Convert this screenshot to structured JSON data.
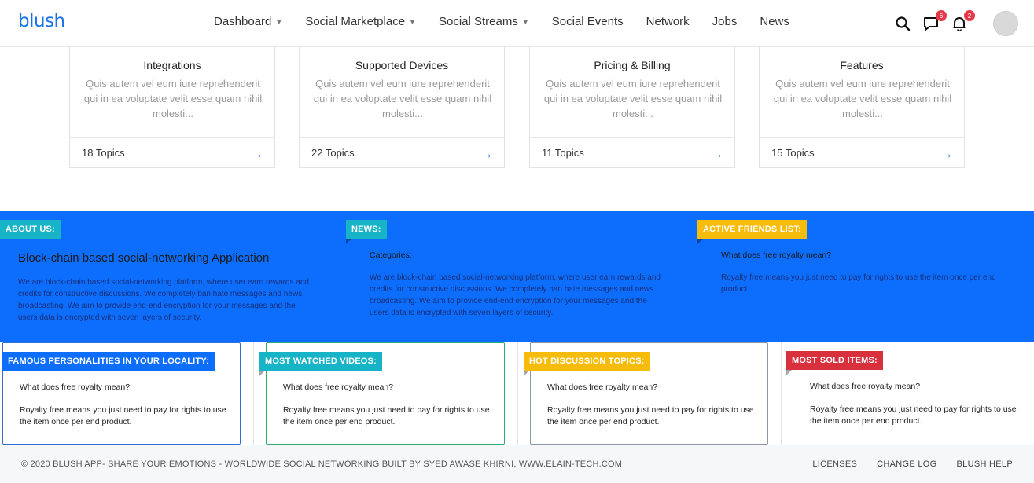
{
  "header": {
    "logo": "blush",
    "nav": [
      {
        "label": "Dashboard",
        "dropdown": true
      },
      {
        "label": "Social Marketplace",
        "dropdown": true
      },
      {
        "label": "Social Streams",
        "dropdown": true
      },
      {
        "label": "Social Events",
        "dropdown": false
      },
      {
        "label": "Network",
        "dropdown": false
      },
      {
        "label": "Jobs",
        "dropdown": false
      },
      {
        "label": "News",
        "dropdown": false
      }
    ],
    "messages_badge": "6",
    "notifications_badge": "2"
  },
  "cards": [
    {
      "title": "Integrations",
      "text": "Quis autem vel eum iure reprehenderit qui in ea voluptate velit esse quam nihil molesti...",
      "topics": "18 Topics"
    },
    {
      "title": "Supported Devices",
      "text": "Quis autem vel eum iure reprehenderit qui in ea voluptate velit esse quam nihil molesti...",
      "topics": "22 Topics"
    },
    {
      "title": "Pricing & Billing",
      "text": "Quis autem vel eum iure reprehenderit qui in ea voluptate velit esse quam nihil molesti...",
      "topics": "11 Topics"
    },
    {
      "title": "Features",
      "text": "Quis autem vel eum iure reprehenderit qui in ea voluptate velit esse quam nihil molesti...",
      "topics": "15 Topics"
    }
  ],
  "band": {
    "about": {
      "tag": "ABOUT US:",
      "heading": "Block-chain based social-networking Application",
      "text": "We are block-chain based social-networking platform, where user earn rewards and credits for constructive discussions. We completely ban hate messages and news broadcasting. We aim to provide end-end encryption for your messages and the users data is encrypted with seven layers of security."
    },
    "news": {
      "tag": "NEWS:",
      "categories": "Categories:",
      "text": "We are block-chain based social-networking platform, where user earn rewards and credits for constructive discussions. We completely ban hate messages and news broadcasting. We aim to provide end-end encryption for your messages and the users data is encrypted with seven layers of security."
    },
    "friends": {
      "tag": "ACTIVE FRIENDS LIST:",
      "question": "What does free royalty mean?",
      "answer": "Royalty free means you just need to pay for rights to use the item once per end product."
    }
  },
  "boxes": [
    {
      "tag": "FAMOUS PERSONALITIES IN YOUR LOCALITY:",
      "question": "What does free royalty mean?",
      "answer": "Royalty free means you just need to pay for rights to use the item once per end product."
    },
    {
      "tag": "MOST WATCHED VIDEOS:",
      "question": "What does free royalty mean?",
      "answer": "Royalty free means you just need to pay for rights to use the item once per end product."
    },
    {
      "tag": "HOT DISCUSSION TOPICS:",
      "question": "What does free royalty mean?",
      "answer": "Royalty free means you just need to pay for rights to use the item once per end product."
    },
    {
      "tag": "MOST SOLD ITEMS:",
      "question": "What does free royalty mean?",
      "answer": "Royalty free means you just need to pay for rights to use the item once per end product."
    }
  ],
  "footer": {
    "copyright": "© 2020 BLUSH APP- SHARE YOUR EMOTIONS - WORLDWIDE SOCIAL NETWORKING BUILT BY SYED AWASE KHIRNI, WWW.ELAIN-TECH.COM",
    "links": [
      "LICENSES",
      "CHANGE LOG",
      "BLUSH HELP"
    ]
  },
  "colors": {
    "brand_blue": "#0d6efd",
    "cyan": "#17b4c8",
    "yellow": "#f7bb0a",
    "red": "#d9303e",
    "badge_red": "#e53947"
  },
  "icons": [
    "search-icon",
    "chat-icon",
    "bell-icon",
    "arrow-right-icon",
    "chevron-down-icon"
  ]
}
